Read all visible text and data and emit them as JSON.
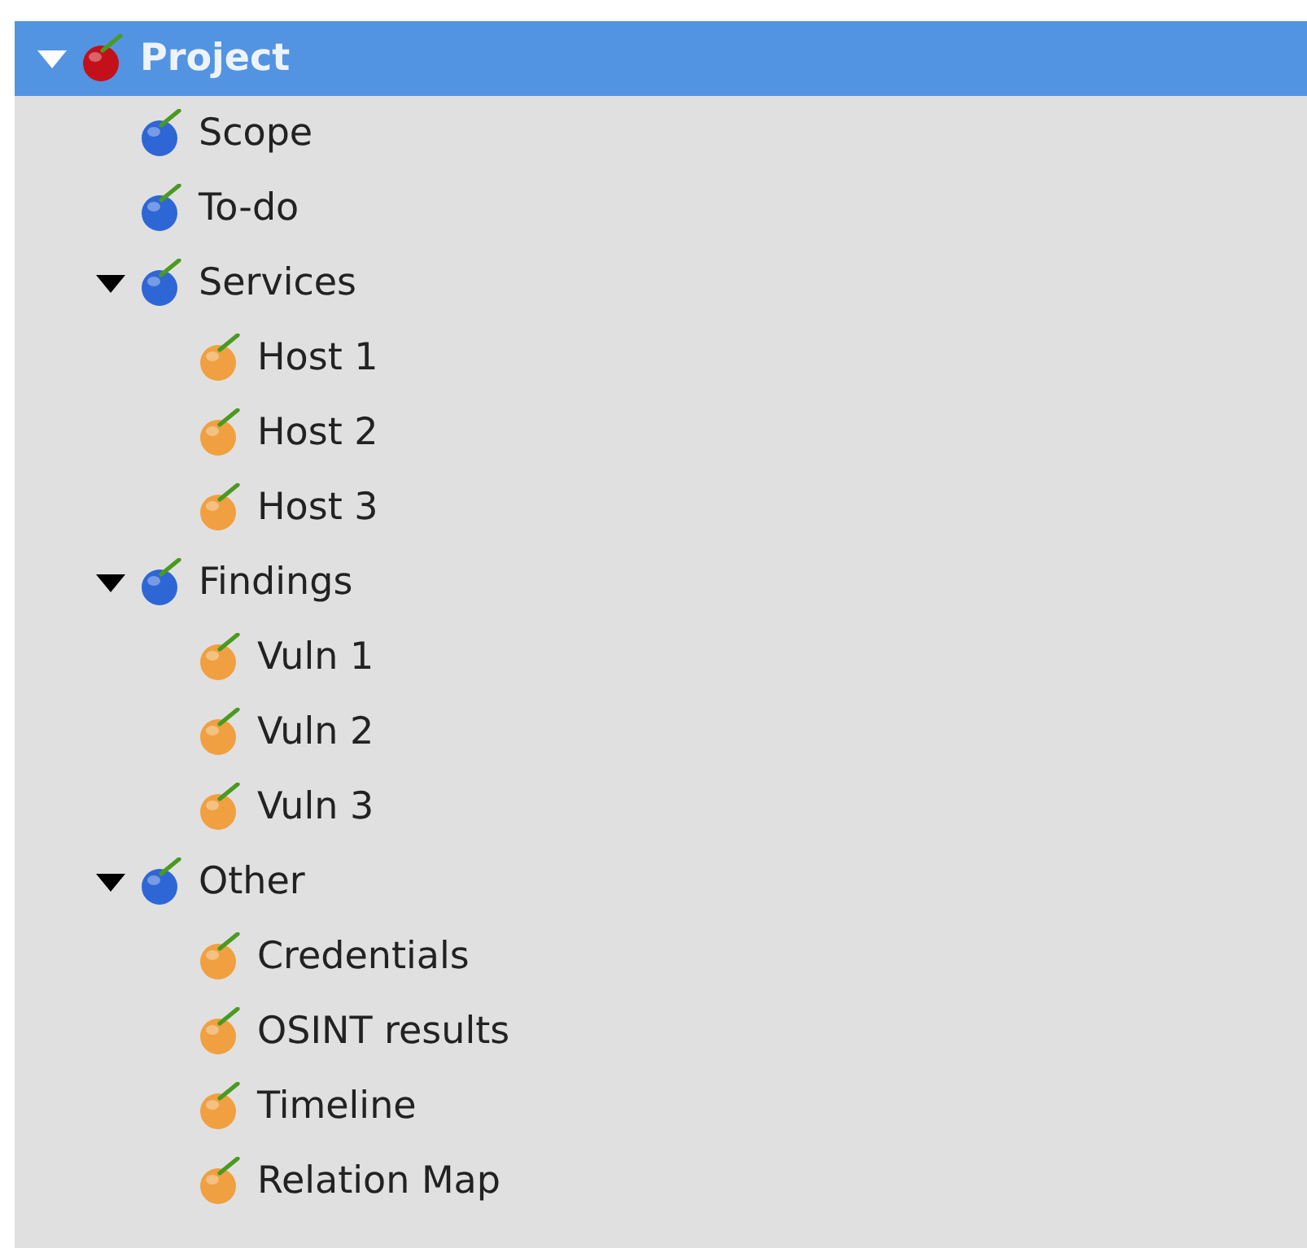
{
  "tree": [
    {
      "label": "Project",
      "color": "#c4101a",
      "selected": true,
      "expanded": true,
      "children": [
        {
          "label": "Scope",
          "color": "#2f66d6",
          "selected": false
        },
        {
          "label": "To-do",
          "color": "#2f66d6",
          "selected": false
        },
        {
          "label": "Services",
          "color": "#2f66d6",
          "selected": false,
          "expanded": true,
          "children": [
            {
              "label": "Host 1",
              "color": "#f0a040",
              "selected": false
            },
            {
              "label": "Host 2",
              "color": "#f0a040",
              "selected": false
            },
            {
              "label": "Host 3",
              "color": "#f0a040",
              "selected": false
            }
          ]
        },
        {
          "label": "Findings",
          "color": "#2f66d6",
          "selected": false,
          "expanded": true,
          "children": [
            {
              "label": "Vuln 1",
              "color": "#f0a040",
              "selected": false
            },
            {
              "label": "Vuln 2",
              "color": "#f0a040",
              "selected": false
            },
            {
              "label": "Vuln 3",
              "color": "#f0a040",
              "selected": false
            }
          ]
        },
        {
          "label": "Other",
          "color": "#2f66d6",
          "selected": false,
          "expanded": true,
          "children": [
            {
              "label": "Credentials",
              "color": "#f0a040",
              "selected": false
            },
            {
              "label": "OSINT results",
              "color": "#f0a040",
              "selected": false
            },
            {
              "label": "Timeline",
              "color": "#f0a040",
              "selected": false
            },
            {
              "label": "Relation Map",
              "color": "#f0a040",
              "selected": false
            }
          ]
        }
      ]
    }
  ]
}
